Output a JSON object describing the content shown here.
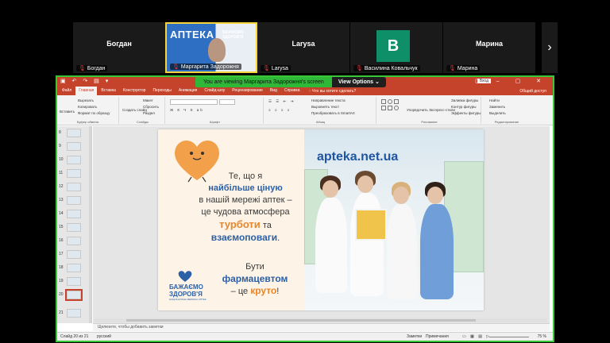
{
  "participants": [
    {
      "name": "Богдан",
      "label": "Богдан"
    },
    {
      "name": "",
      "label": "Маргарита Задорожня",
      "banner": "АПТЕКА",
      "banner_sub": "БАЖАЄМО ЗДОРОВ'Я"
    },
    {
      "name": "Larysa",
      "label": "Larysa"
    },
    {
      "name": "",
      "label": "Василина Ковальчук",
      "initial": "B"
    },
    {
      "name": "Марина",
      "label": "Марина"
    }
  ],
  "share_bar": {
    "viewing_text": "You are viewing Маргарита Задорожня's screen",
    "view_options": "View Options"
  },
  "window": {
    "login": "Вход"
  },
  "tabs": [
    "Файл",
    "Главная",
    "Вставка",
    "Конструктор",
    "Переходы",
    "Анимация",
    "Слайд-шоу",
    "Рецензирование",
    "Вид",
    "Справка"
  ],
  "tell_me": "Что вы хотите сделать?",
  "share_access": "Общий доступ",
  "ribbon": {
    "clipboard": {
      "paste": "Вставить",
      "cut": "Вырезать",
      "copy": "Копировать",
      "format": "Формат по образцу",
      "label": "Буфер обмена"
    },
    "slides": {
      "new": "Создать слайд",
      "layout": "Макет",
      "reset": "Сбросить",
      "section": "Раздел",
      "label": "Слайды"
    },
    "font": {
      "label": "Шрифт"
    },
    "paragraph": {
      "direction": "Направление текста",
      "align": "Выровнять текст",
      "smartart": "Преобразовать в SmartArt",
      "label": "Абзац"
    },
    "drawing": {
      "arrange": "Упорядочить",
      "styles": "Экспресс-стили",
      "fill": "Заливка фигуры",
      "outline": "Контур фигуры",
      "effects": "Эффекты фигуры",
      "label": "Рисование"
    },
    "editing": {
      "find": "Найти",
      "replace": "Заменить",
      "select": "Выделить",
      "label": "Редактирование"
    }
  },
  "thumbnails": [
    "8",
    "9",
    "10",
    "11",
    "12",
    "13",
    "14",
    "15",
    "16",
    "17",
    "18",
    "19",
    "20",
    "21"
  ],
  "selected_thumbnail": "20",
  "slide": {
    "line1": "Те, що я",
    "line2": "найбільше ціную",
    "line3": "в нашій мережі аптек –",
    "line4": "це чудова атмосфера",
    "line5": "турботи",
    "line5b": "та",
    "line6": "взаємоповаги",
    "line6b": ".",
    "line7": "Бути",
    "line8": "фармацевтом",
    "line9": "– це",
    "line9b": "круто",
    "line9c": "!",
    "logo_word": "БАЖАЄМО ЗДОРОВ'Я",
    "logo_sub": "НАЦІОНАЛЬНА МЕРЕЖА АПТЕК",
    "shop_sign": "apteka.net.ua"
  },
  "notes_placeholder": "Щелкните, чтобы добавить заметки",
  "status": {
    "slide_info": "Слайд 20 из 21",
    "lang": "русский",
    "notes": "Заметки",
    "comments": "Примечания",
    "zoom": "75 %"
  },
  "colors": {
    "accent": "#c5432a",
    "share_border": "#37c737",
    "brand_blue": "#2b5fa6",
    "brand_orange": "#e8872a"
  }
}
